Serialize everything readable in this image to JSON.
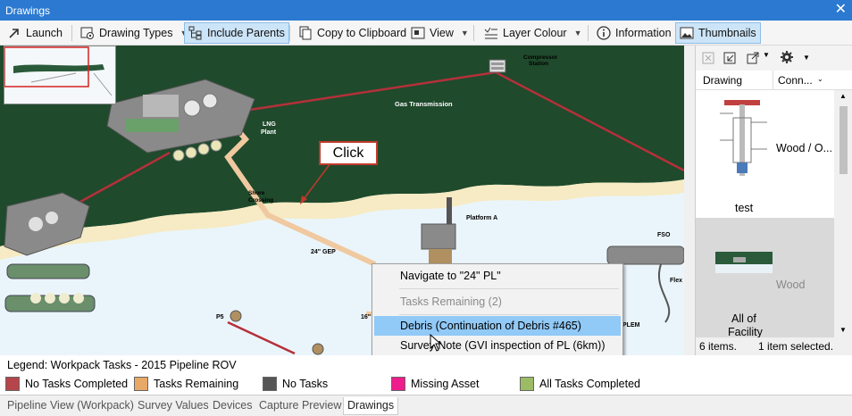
{
  "window": {
    "title": "Drawings",
    "close_glyph": "✕"
  },
  "toolbar": {
    "launch": "Launch",
    "drawing_types": "Drawing Types",
    "include_parents": "Include Parents",
    "copy_clipboard": "Copy to Clipboard",
    "view": "View",
    "layer_colour": "Layer Colour",
    "information": "Information",
    "thumbnails": "Thumbnails"
  },
  "map": {
    "labels": {
      "compressor_station_1": "Compressor",
      "compressor_station_2": "Station",
      "gas_transmission": "Gas Transmission",
      "lng_plant_1": "LNG",
      "lng_plant_2": "Plant",
      "shore_crossing_1": "Shore",
      "shore_crossing_2": "Crossing",
      "platform_a": "Platform A",
      "gep_24": "24\" GEP",
      "fso": "FSO",
      "p5": "P5",
      "pipe_16": "16\"",
      "plem": "PLEM",
      "flex": "Flex"
    },
    "callout": "Click"
  },
  "context_menu": {
    "items": [
      {
        "label": "Navigate to \"24\" PL\"",
        "accel": "N",
        "disabled": false
      },
      {
        "label": "Tasks Remaining (2)",
        "accel": "T",
        "disabled": true
      },
      {
        "label": "Debris (Continuation of Debris #465)",
        "accel": "D",
        "disabled": false
      },
      {
        "label": "Survey Note (GVI inspection of PL (6km))",
        "accel": "S",
        "disabled": false
      }
    ]
  },
  "right_panel": {
    "columns": {
      "drawing": "Drawing",
      "conn": "Conn..."
    },
    "items": [
      {
        "name": "test",
        "conn": "Wood / O..."
      },
      {
        "name": "All of Facility",
        "name_line1": "All of",
        "name_line2": "Facility",
        "conn": "Wood"
      }
    ],
    "status_count": "6 items.",
    "status_selected": "1 item selected."
  },
  "legend": {
    "title": "Legend: Workpack Tasks - 2015 Pipeline ROV",
    "items": [
      {
        "label": "No Tasks Completed",
        "color": "#b5454a"
      },
      {
        "label": "Tasks Remaining",
        "color": "#e8a868"
      },
      {
        "label": "No Tasks",
        "color": "#555555"
      },
      {
        "label": "Missing Asset",
        "color": "#ee1c8c"
      },
      {
        "label": "All Tasks Completed",
        "color": "#9bbb64"
      }
    ]
  },
  "tabs": [
    {
      "label": "Pipeline View (Workpack)",
      "active": false
    },
    {
      "label": "Survey Values",
      "active": false
    },
    {
      "label": "Devices",
      "active": false
    },
    {
      "label": "Capture Preview",
      "active": false
    },
    {
      "label": "Drawings",
      "active": true
    }
  ],
  "colors": {
    "title_bar": "#2b79d0",
    "land": "#1f4a2c",
    "sea": "#eaf5fb",
    "beach": "#f6ebc4",
    "pipeline_highlight": "#f0c9a0",
    "red_line": "#b5303a",
    "menu_hover": "#91c9f7"
  },
  "icons": {
    "launch": "arrow-up-right-icon",
    "drawing_types": "drawing-types-icon",
    "include_parents": "hierarchy-icon",
    "copy": "copy-icon",
    "view": "view-icon",
    "layer_colour": "layers-icon",
    "information": "info-icon",
    "thumbnails": "image-icon"
  }
}
